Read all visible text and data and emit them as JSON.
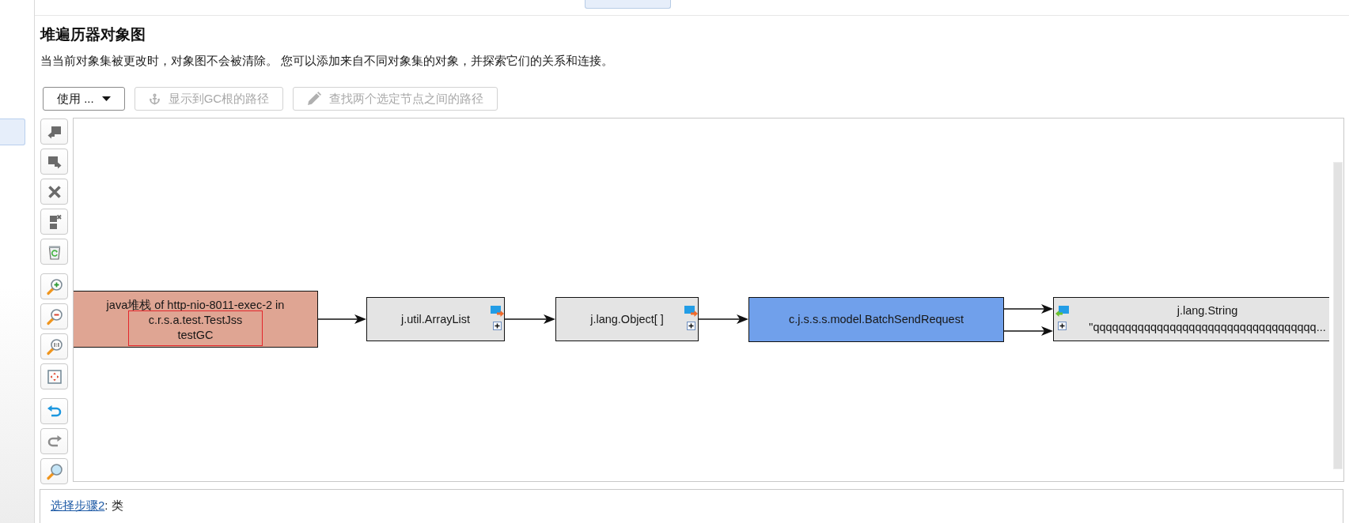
{
  "title": "堆遍历器对象图",
  "description": "当当前对象集被更改时，对象图不会被清除。 您可以添加来自不同对象集的对象，并探索它们的关系和连接。",
  "toolbar": [
    {
      "label": "使用 ...",
      "kind": "menu",
      "disabled": false
    },
    {
      "label": "显示到GC根的路径",
      "kind": "anchor",
      "disabled": true
    },
    {
      "label": "查找两个选定节点之间的路径",
      "kind": "pencil",
      "disabled": true
    }
  ],
  "graph": {
    "nodes": [
      {
        "kind": "root",
        "title": "java堆栈 of http-nio-8011-exec-2 in",
        "lines": [
          "c.r.s.a.test.TestJss",
          "testGC"
        ],
        "marked": true,
        "color": "#dfa593",
        "outgoing": [
          {
            "kind": "reference"
          }
        ]
      },
      {
        "kind": "outgoing",
        "title": "j.util.ArrayList",
        "color": "#e4e4e4",
        "outgoing": [
          {
            "kind": "reference"
          }
        ]
      },
      {
        "kind": "outgoing",
        "title": "j.lang.Object[ ]",
        "color": "#e4e4e4",
        "outgoing": [
          {
            "kind": "reference"
          }
        ]
      },
      {
        "kind": "plain",
        "title": "c.j.s.s.s.model.BatchSendRequest",
        "color": "#70a0eb",
        "outgoing": [
          {
            "kind": "reference"
          },
          {
            "kind": "reference"
          }
        ]
      },
      {
        "kind": "incoming",
        "title": "j.lang.String",
        "lines": [
          "\"qqqqqqqqqqqqqqqqqqqqqqqqqqqqqqqqqqq..."
        ],
        "color": "#e4e4e4"
      }
    ]
  },
  "step": {
    "link": "选择步骤2",
    "rest": ": 类"
  }
}
